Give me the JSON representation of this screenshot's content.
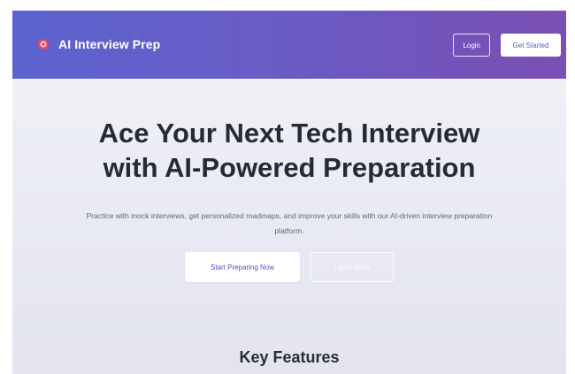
{
  "navbar": {
    "brand_icon": "target-icon",
    "brand_name": "AI Interview Prep",
    "login_label": "Login",
    "get_started_label": "Get Started"
  },
  "hero": {
    "title_line1": "Ace Your Next Tech Interview",
    "title_line2": "with AI-Powered Preparation",
    "subtitle": "Practice with mock interviews, get personalized roadmaps, and improve your skills with our AI-driven interview preparation platform.",
    "primary_cta": "Start Preparing Now",
    "secondary_cta": "Learn More"
  },
  "features": {
    "heading": "Key Features"
  },
  "colors": {
    "nav_gradient_start": "#5b63cf",
    "nav_gradient_end": "#7a4fb3",
    "brand_icon": "#e0476a",
    "page_background": "#eceef5",
    "heading_text": "#272a33"
  }
}
